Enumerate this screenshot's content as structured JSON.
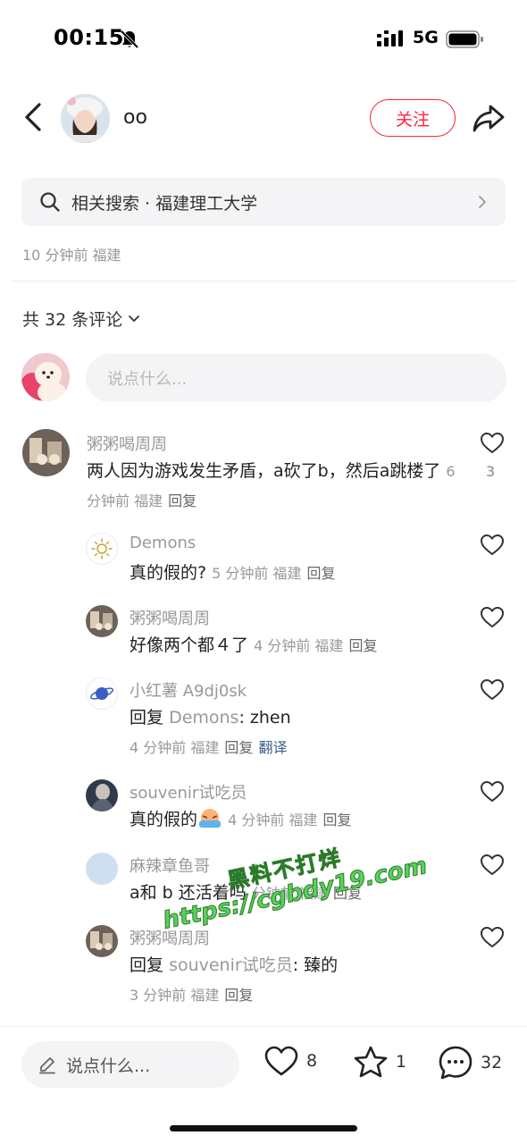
{
  "status_bar": {
    "time": "00:15",
    "network": "5G"
  },
  "header": {
    "author_name": "oo",
    "follow_label": "关注"
  },
  "related_search": {
    "text": "相关搜索 · 福建理工大学"
  },
  "post_meta": "10 分钟前 福建",
  "comments_header": {
    "label": "共 32 条评论"
  },
  "comment_input": {
    "placeholder": "说点什么..."
  },
  "comments": [
    {
      "user": "粥粥喝周周",
      "text": "两人因为游戏发生矛盾，a砍了b，然后a跳楼了",
      "meta": "6 分钟前 福建",
      "reply": "回复",
      "likes": "3"
    },
    {
      "user": "Demons",
      "text": "真的假的?",
      "meta": "5 分钟前 福建",
      "reply": "回复"
    },
    {
      "user": "粥粥喝周周",
      "text": "好像两个都４了",
      "meta": "4 分钟前 福建",
      "reply": "回复"
    },
    {
      "user": "小红薯 A9dj0sk",
      "prefix": "回复",
      "mention": "Demons",
      "text": ": zhen",
      "meta": "4 分钟前 福建",
      "reply": "回复",
      "translate": "翻译"
    },
    {
      "user": "souvenir试吃员",
      "text": "真的假的",
      "meta": "4 分钟前 福建",
      "reply": "回复"
    },
    {
      "user": "麻辣章鱼哥",
      "text": "a和 b 还活着吗",
      "meta": "分钟前 福建",
      "reply": "回复"
    },
    {
      "user": "粥粥喝周周",
      "prefix": "回复",
      "mention": "souvenir试吃员",
      "text": ": 臻的",
      "meta": "3 分钟前 福建",
      "reply": "回复"
    }
  ],
  "watermark": {
    "line1": "黑料不打烊",
    "line2": "https://cgbdy19.com"
  },
  "bottom_bar": {
    "input_placeholder": "说点什么...",
    "likes": "8",
    "favorites": "1",
    "comments": "32"
  },
  "colors": {
    "accent": "#ff2442",
    "muted": "#999999",
    "link": "#3a5f8c"
  }
}
